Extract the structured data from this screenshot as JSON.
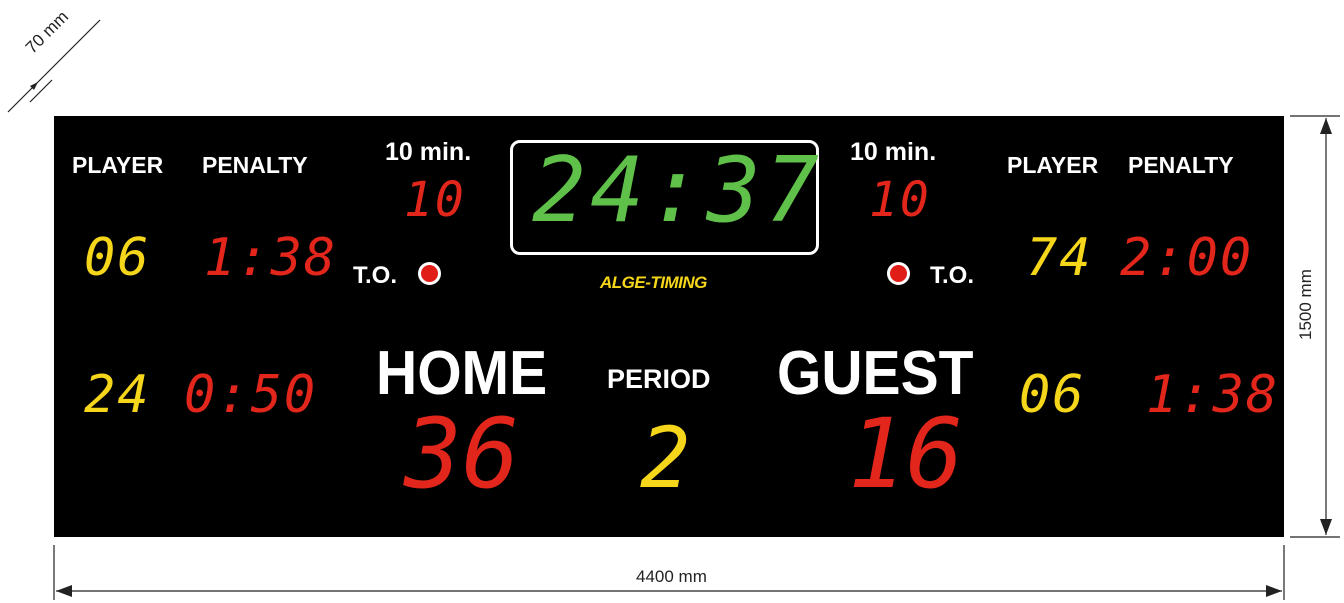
{
  "dimensions": {
    "depth": "70 mm",
    "height": "1500 mm",
    "width": "4400 mm"
  },
  "scoreboard": {
    "brand": "ALGE-TIMING",
    "clock": "24:37",
    "home": {
      "label": "HOME",
      "score": "36",
      "timeout_label": "T.O.",
      "ten_min_label": "10 min.",
      "ten_min_value": "10",
      "player_label": "PLAYER",
      "penalty_label": "PENALTY",
      "penalties": [
        {
          "player": "06",
          "time": "1:38"
        },
        {
          "player": "24",
          "time": "0:50"
        }
      ]
    },
    "guest": {
      "label": "GUEST",
      "score": "16",
      "timeout_label": "T.O.",
      "ten_min_label": "10 min.",
      "ten_min_value": "10",
      "player_label": "PLAYER",
      "penalty_label": "PENALTY",
      "penalties": [
        {
          "player": "74",
          "time": "2:00"
        },
        {
          "player": "06",
          "time": "1:38"
        }
      ]
    },
    "period": {
      "label": "PERIOD",
      "value": "2"
    },
    "colors": {
      "board": "#000000",
      "player_digits": "#f5d61a",
      "time_digits": "#e3261b",
      "clock_digits": "#5fc04a",
      "timeout_lamp": "#e11d18"
    }
  }
}
